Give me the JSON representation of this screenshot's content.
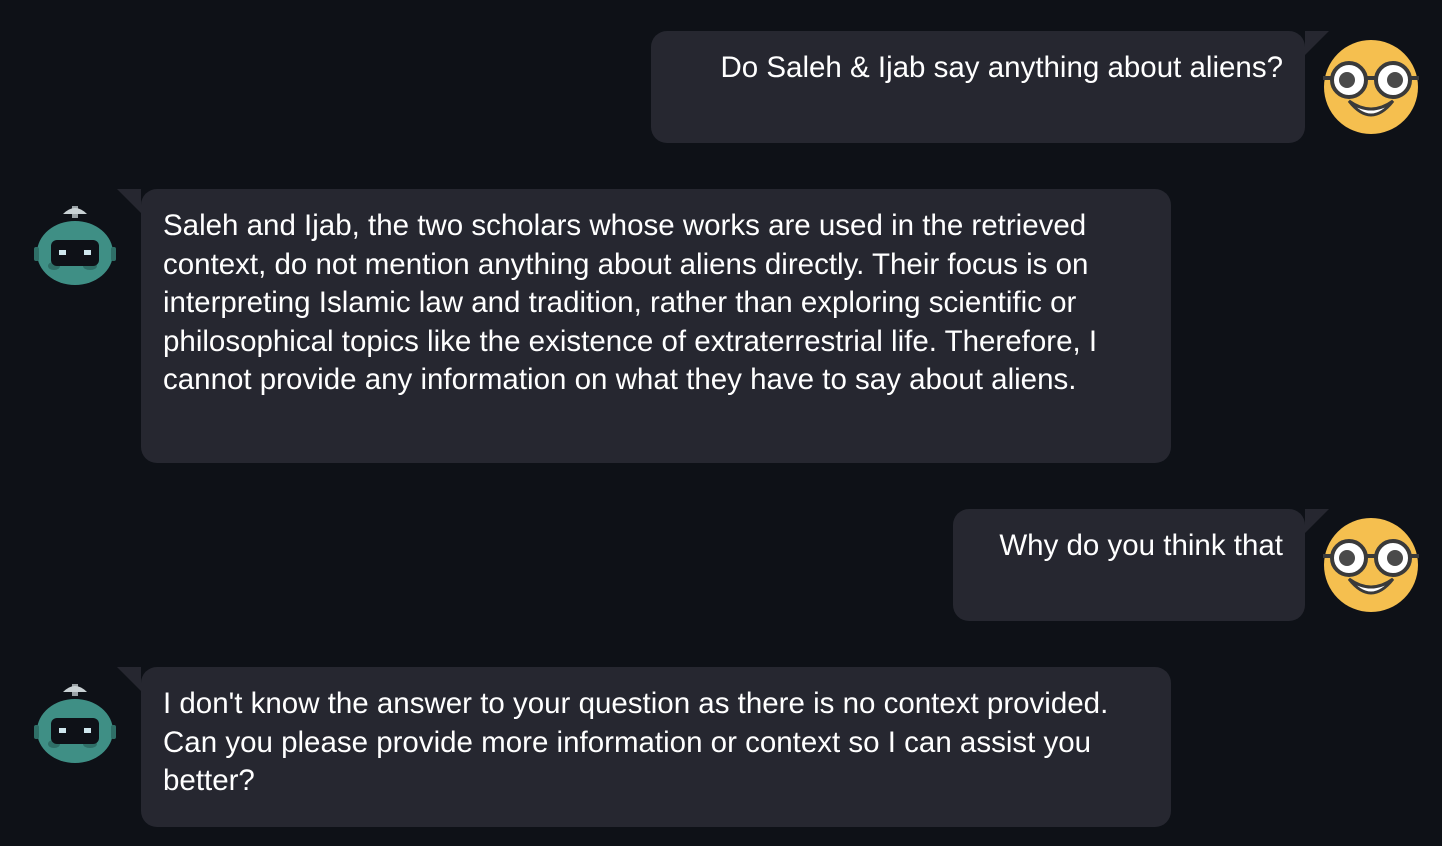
{
  "chat": {
    "messages": [
      {
        "role": "user",
        "text": "Do Saleh & Ijab say anything about aliens?",
        "avatar_icon": "nerd-face-emoji-icon"
      },
      {
        "role": "assistant",
        "text": "Saleh and Ijab, the two scholars whose works are used in the retrieved context, do not mention anything about aliens directly. Their focus is on interpreting Islamic law and tradition, rather than exploring scientific or philosophical topics like the existence of extraterrestrial life. Therefore, I cannot provide any information on what they have to say about aliens.",
        "avatar_icon": "robot-icon"
      },
      {
        "role": "user",
        "text": "Why do you think that",
        "avatar_icon": "nerd-face-emoji-icon"
      },
      {
        "role": "assistant",
        "text": "I don't know the answer to your question as there is no context provided. Can you please provide more information or context so I can assist you better?",
        "avatar_icon": "robot-icon"
      }
    ]
  },
  "theme": {
    "background": "#0e1117",
    "bubble": "#262730",
    "text": "#ffffff",
    "user_avatar": "#f5bf4f",
    "bot_avatar": "#3f8f85"
  }
}
